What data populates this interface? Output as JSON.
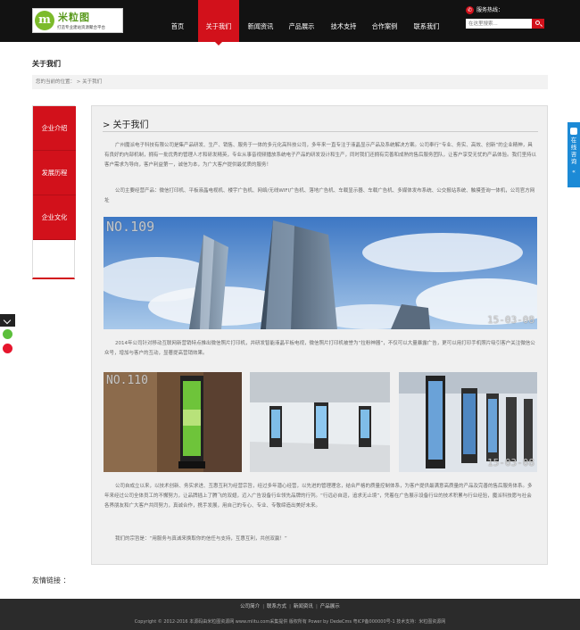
{
  "header": {
    "logo": {
      "mark": "m",
      "brand": "米粒图",
      "slogan": "打造专业建站资源聚合平台"
    },
    "nav": [
      {
        "label": "首页",
        "active": false
      },
      {
        "label": "关于我们",
        "active": true
      },
      {
        "label": "新闻资讯",
        "active": false
      },
      {
        "label": "产品展示",
        "active": false
      },
      {
        "label": "技术支持",
        "active": false
      },
      {
        "label": "合作案例",
        "active": false
      },
      {
        "label": "联系我们",
        "active": false
      }
    ],
    "hotline_label": "服务热线：",
    "search": {
      "placeholder": "在这里搜索..."
    }
  },
  "page": {
    "title": "关于我们",
    "breadcrumb": "您的当前的位置： > 关于我们"
  },
  "sidebar": {
    "items": [
      {
        "label": "企业介绍"
      },
      {
        "label": "发展历程"
      },
      {
        "label": "企业文化"
      }
    ]
  },
  "main": {
    "section_title": "> 关于我们",
    "paragraphs": [
      "广州魔派电子科技有限公司是集产品研发、生产、销售、服务于一体的多元化高科技公司，多年来一直专注于液晶显示产品及系统解决方案。公司奉行“专业、务实、高效、创新”的企业精神，具有良好的内部机制，拥有一批优秀的管理人才和研发精英，专业从事音视频播放系统电子产品的研发设计和生产，同时我们还拥有完善和成熟的售后服务团队，让客户享受无忧的产品体验。我们坚持以客户需求为导向，客户利益第一，诚信为本，为广大客户提供最优质的服务！",
      "公司主要经营产品：微信打印机、平板液晶电视机、楼宇广告机、网络/无线WIFI广告机、落地广告机、车载显示器、车载广告机、多媒体发布系统、公交报站系统、触摸查询一体机，公司官方网址",
      "2014年公司针对移动互联网新营销特点推出微信照片打印机，并研发智能液晶平板电视，微信照片打印机被誉为“拉粉神器”，不仅可以大量暴露广告，更可以用打印手机照片吸引客户关注微信公众号，增加与客户的互动，显著提高营销效果。",
      "公司自成立以来，以技术创新、务实求进、互惠互利为经营宗旨，经过多年潜心经营，以先进的管理理念，结合严格的质量控制体系，为客户提供最满意高质量的产品及完善的售后服务体系。多年来经过公司全体员工的不懈努力，让品牌插上了腾飞的双翅，迈入广告设备行业领先品牌的行列。“行远必自迩，追求无止境”，凭着在广告展示设备行业的技术积累与行业经验，魔派科技愿与社会各界朋友和广大客户共同努力，真诚合作，携手发展，用自己的专心、专业、专敬缔造出美好未来。",
      "我们的宗旨是：“用服务与真诚来换取你的信任与支持，互惠互利，共创双赢！”"
    ],
    "banner_image": {
      "watermark_tl": "NO.109",
      "watermark_br": "15-03-08"
    },
    "photos": [
      {
        "watermark_tl": "NO.110"
      },
      {
        "watermark_tl": ""
      },
      {
        "watermark_br": "15-03-08"
      }
    ]
  },
  "floating": {
    "online_consult": "在线咨询",
    "consult_arrow": "«"
  },
  "friend_links": {
    "label": "友情链接 ："
  },
  "footer": {
    "links": [
      "公司简介",
      "联系方式",
      "新闻资讯",
      "产品展示"
    ],
    "separator": "|",
    "copyright": "Copyright © 2012-2016 本源码由米粒图资源网 www.mlitu.com采集提供 版权所有 Power by DedeCms 粤ICP备000000号-1 技术支持：米粒图资源网"
  },
  "colors": {
    "brand_red": "#d2111b",
    "header_bg": "#121212",
    "footer_bg": "#2b2b2b",
    "consult_blue": "#1c8ad6"
  }
}
